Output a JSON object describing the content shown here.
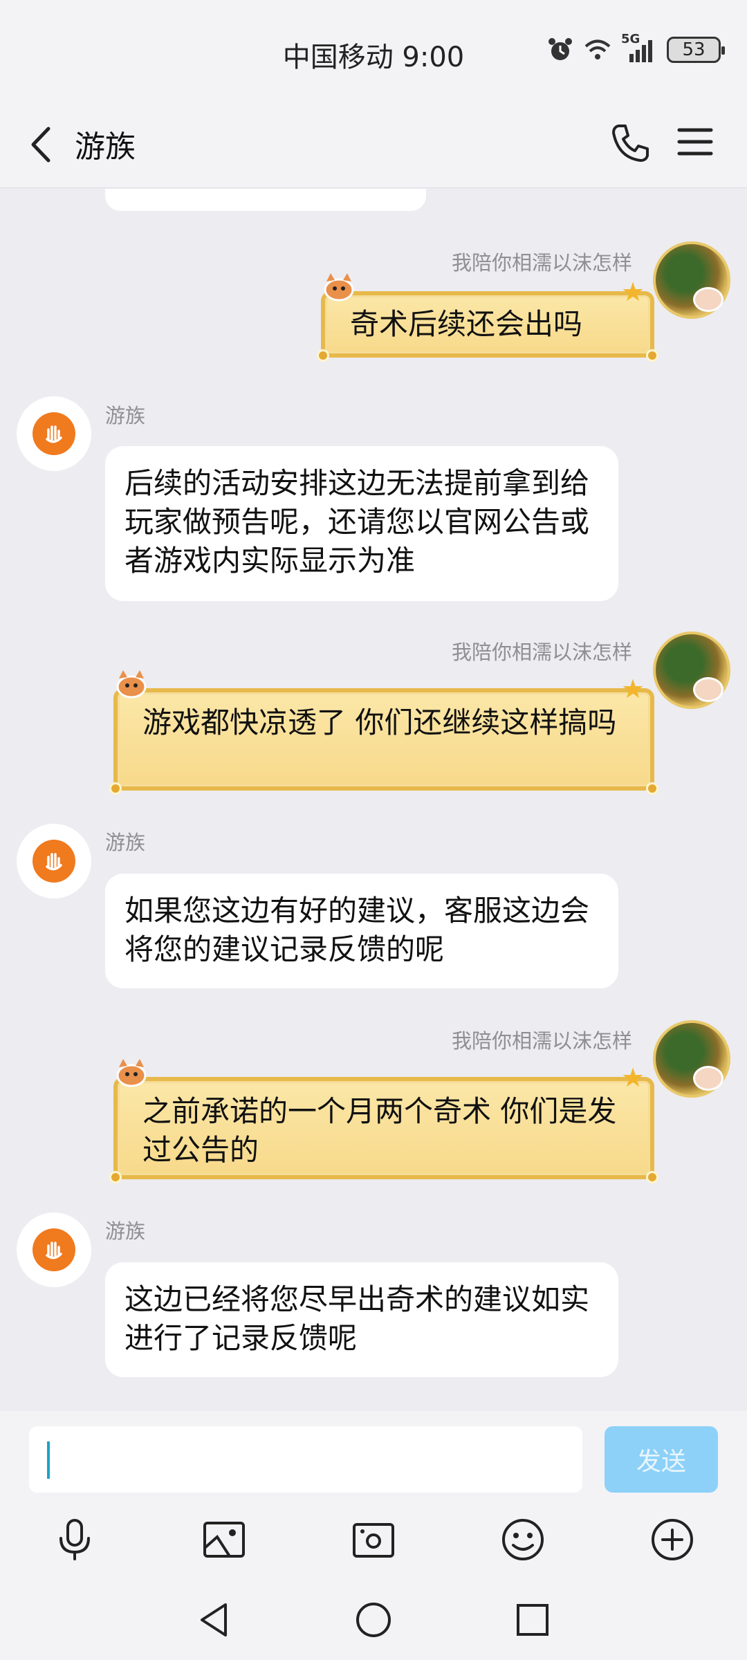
{
  "status": {
    "carrier_time": "中国移动 9:00",
    "network": "5G",
    "battery": "53"
  },
  "header": {
    "title": "游族"
  },
  "messages": [
    {
      "sender": "user",
      "nick": "我陪你相濡以沫怎样",
      "text": "奇术后续还会出吗"
    },
    {
      "sender": "agent",
      "nick": "游族",
      "text": "后续的活动安排这边无法提前拿到给玩家做预告呢，还请您以官网公告或者游戏内实际显示为准"
    },
    {
      "sender": "user",
      "nick": "我陪你相濡以沫怎样",
      "text": "游戏都快凉透了 你们还继续这样搞吗"
    },
    {
      "sender": "agent",
      "nick": "游族",
      "text": "如果您这边有好的建议，客服这边会将您的建议记录反馈的呢"
    },
    {
      "sender": "user",
      "nick": "我陪你相濡以沫怎样",
      "text": "之前承诺的一个月两个奇术 你们是发过公告的"
    },
    {
      "sender": "agent",
      "nick": "游族",
      "text": "这边已经将您尽早出奇术的建议如实进行了记录反馈呢"
    }
  ],
  "input": {
    "value": "",
    "send_label": "发送"
  },
  "icons": {
    "brand_color": "#f07a1e",
    "send_color": "#8dd1f8",
    "bubble_gold": "#e7b94a"
  }
}
